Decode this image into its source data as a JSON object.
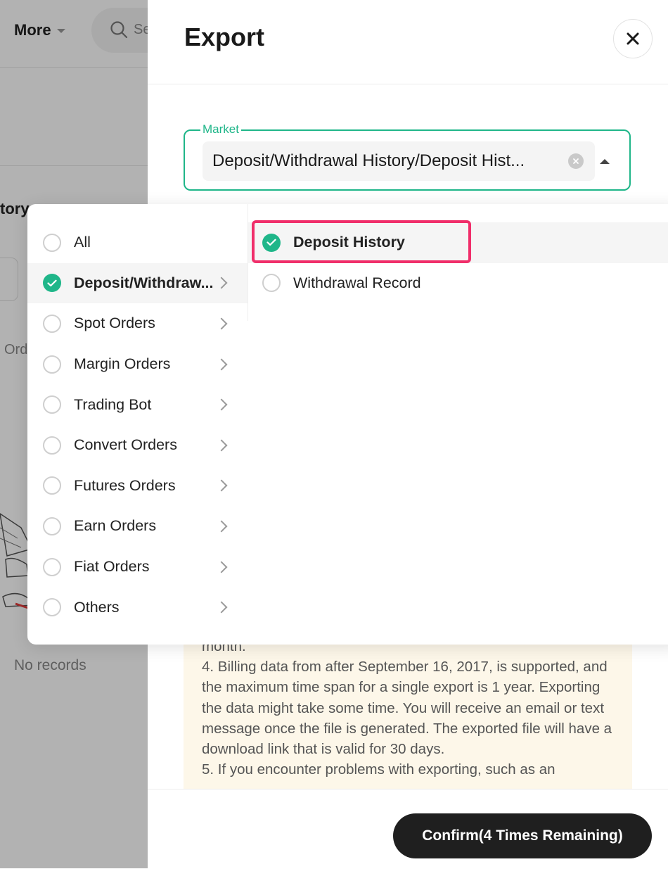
{
  "background": {
    "more_label": "More",
    "search_placeholder": "Se",
    "tab_partial": "tory",
    "orders_partial": "Ord",
    "empty_text": "No records"
  },
  "drawer": {
    "title": "Export",
    "market": {
      "legend": "Market",
      "value": "Deposit/Withdrawal History/Deposit Hist..."
    },
    "notes": [
      "month.",
      "4. Billing data from after September 16, 2017, is supported, and the maximum time span for a single export is 1 year. Exporting the data might take some time. You will receive an email or text message once the file is generated. The exported file will have a download link that is valid for 30 days.",
      "5. If you encounter problems with exporting, such as an"
    ],
    "confirm_label": "Confirm(4 Times Remaining)"
  },
  "cascader": {
    "categories": [
      {
        "label": "All",
        "checked": false
      },
      {
        "label": "Deposit/Withdraw...",
        "checked": true
      },
      {
        "label": "Spot Orders",
        "checked": false
      },
      {
        "label": "Margin Orders",
        "checked": false
      },
      {
        "label": "Trading Bot",
        "checked": false
      },
      {
        "label": "Convert Orders",
        "checked": false
      },
      {
        "label": "Futures Orders",
        "checked": false
      },
      {
        "label": "Earn Orders",
        "checked": false
      },
      {
        "label": "Fiat Orders",
        "checked": false
      },
      {
        "label": "Others",
        "checked": false
      }
    ],
    "subcategories": [
      {
        "label": "Deposit History",
        "checked": true
      },
      {
        "label": "Withdrawal Record",
        "checked": false
      }
    ]
  },
  "colors": {
    "accent": "#1fb689",
    "highlight": "#f02e6a",
    "button": "#1f1f1f",
    "notes_bg": "#fdf7e9"
  }
}
